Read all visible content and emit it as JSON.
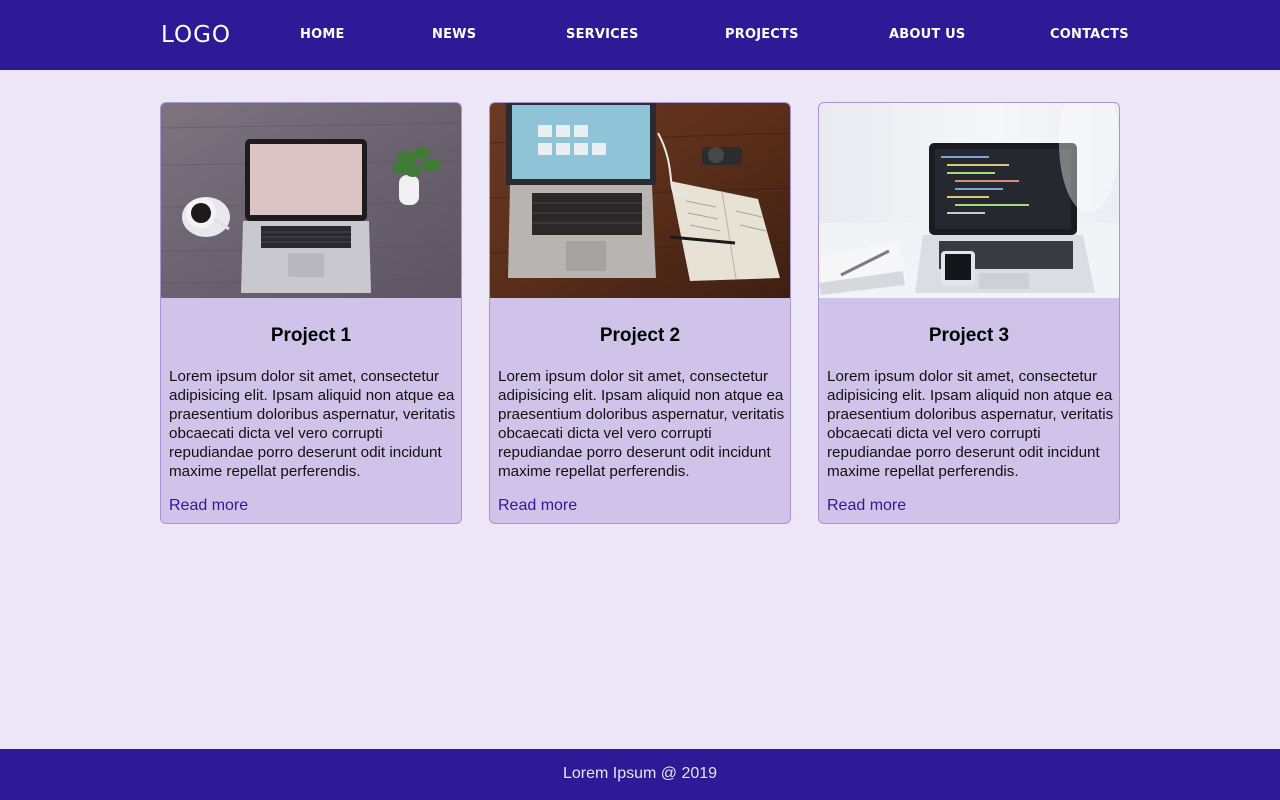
{
  "header": {
    "logo": "LOGO",
    "nav": [
      {
        "label": "HOME"
      },
      {
        "label": "NEWS"
      },
      {
        "label": "SERVICES"
      },
      {
        "label": "PROJECTS"
      },
      {
        "label": "ABOUT US"
      },
      {
        "label": "CONTACTS"
      }
    ]
  },
  "cards": [
    {
      "title": "Project 1",
      "text": "Lorem ipsum dolor sit amet, consectetur adipisicing elit. Ipsam aliquid non atque ea praesentium doloribus aspernatur, veritatis obcaecati dicta vel vero corrupti repudiandae porro deserunt odit incidunt maxime repellat perferendis.",
      "link": "Read more"
    },
    {
      "title": "Project 2",
      "text": "Lorem ipsum dolor sit amet, consectetur adipisicing elit. Ipsam aliquid non atque ea praesentium doloribus aspernatur, veritatis obcaecati dicta vel vero corrupti repudiandae porro deserunt odit incidunt maxime repellat perferendis.",
      "link": "Read more"
    },
    {
      "title": "Project 3",
      "text": "Lorem ipsum dolor sit amet, consectetur adipisicing elit. Ipsam aliquid non atque ea praesentium doloribus aspernatur, veritatis obcaecati dicta vel vero corrupti repudiandae porro deserunt odit incidunt maxime repellat perferendis.",
      "link": "Read more"
    }
  ],
  "footer": {
    "text": "Lorem Ipsum @ 2019"
  },
  "colors": {
    "brand": "#2e1a96",
    "page_background": "#ede6f7",
    "card_background": "#cfc3e9",
    "card_border": "#a895d6"
  }
}
